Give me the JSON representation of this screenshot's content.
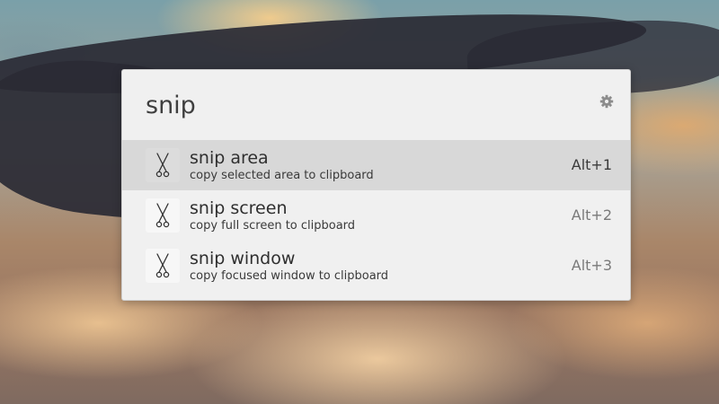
{
  "launcher": {
    "query": "snip",
    "settings_icon": "gear-icon"
  },
  "results": [
    {
      "title": "snip area",
      "description": "copy selected area to clipboard",
      "shortcut": "Alt+1",
      "selected": true,
      "icon": "scissors-icon"
    },
    {
      "title": "snip screen",
      "description": "copy full screen to clipboard",
      "shortcut": "Alt+2",
      "selected": false,
      "icon": "scissors-icon"
    },
    {
      "title": "snip window",
      "description": "copy focused window to clipboard",
      "shortcut": "Alt+3",
      "selected": false,
      "icon": "scissors-icon"
    }
  ],
  "colors": {
    "panel_background": "#f0f0f0",
    "selected_row": "#d8d8d8"
  }
}
